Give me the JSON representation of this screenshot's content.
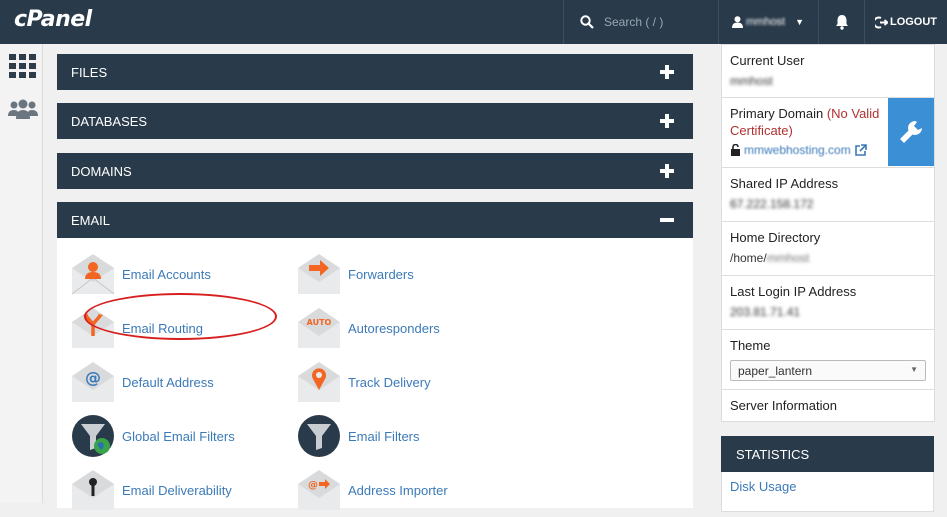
{
  "header": {
    "logo": "cPanel",
    "search_placeholder": "Search ( / )",
    "username": "mmhost",
    "logout": "LOGOUT"
  },
  "panels": {
    "files": "FILES",
    "databases": "DATABASES",
    "domains": "DOMAINS",
    "email": "EMAIL"
  },
  "email_items": [
    {
      "label": "Email Accounts",
      "icon": "email-accounts-icon"
    },
    {
      "label": "Forwarders",
      "icon": "forwarders-icon"
    },
    {
      "label": "Email Routing",
      "icon": "email-routing-icon"
    },
    {
      "label": "Autoresponders",
      "icon": "autoresponders-icon"
    },
    {
      "label": "Default Address",
      "icon": "default-address-icon"
    },
    {
      "label": "Track Delivery",
      "icon": "track-delivery-icon"
    },
    {
      "label": "Global Email Filters",
      "icon": "global-filters-icon"
    },
    {
      "label": "Email Filters",
      "icon": "email-filters-icon"
    },
    {
      "label": "Email Deliverability",
      "icon": "email-deliverability-icon"
    },
    {
      "label": "Address Importer",
      "icon": "address-importer-icon"
    }
  ],
  "sidebar": {
    "current_user_label": "Current User",
    "current_user": "mmhost",
    "primary_domain_label": "Primary Domain",
    "no_cert": "(No Valid Certificate)",
    "domain": "mmwebhosting.com",
    "shared_ip_label": "Shared IP Address",
    "shared_ip": "67.222.158.172",
    "home_dir_label": "Home Directory",
    "home_dir_prefix": "/home/",
    "home_dir_user": "mmhost",
    "last_login_label": "Last Login IP Address",
    "last_login": "203.81.71.41",
    "theme_label": "Theme",
    "theme_value": "paper_lantern",
    "server_info": "Server Information"
  },
  "statistics": {
    "title": "STATISTICS",
    "disk_usage": "Disk Usage"
  },
  "colors": {
    "navy": "#293a4a",
    "link": "#3b7ab8",
    "accent_orange": "#f26522",
    "annotation_red": "#d71f1f"
  }
}
